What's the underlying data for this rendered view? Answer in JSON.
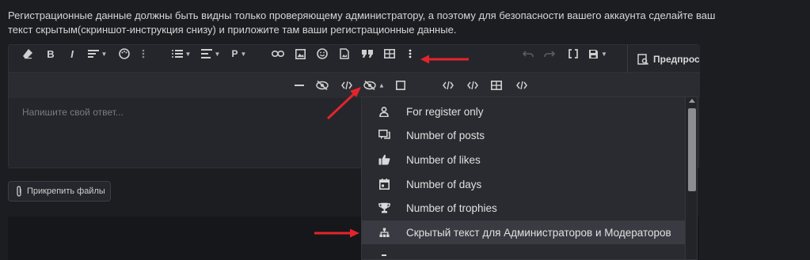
{
  "notice_text": "Регистрационные данные должны быть видны только проверяющему администратору, а поэтому для безопасности вашего аккаунта сделайте ваш текст скрытым(скриншот-инструкция снизу) и приложите там ваши регистрационные данные.",
  "toolbar": {
    "bold": "B",
    "italic": "I",
    "paragraph": "P",
    "preview_label": "Предпросмотр"
  },
  "editor": {
    "placeholder": "Напишите свой ответ..."
  },
  "attach_label": "Прикрепить файлы",
  "dropdown": {
    "items": [
      {
        "label": "For register only",
        "icon": "user-icon"
      },
      {
        "label": "Number of posts",
        "icon": "comments-icon"
      },
      {
        "label": "Number of likes",
        "icon": "thumbs-up-icon"
      },
      {
        "label": "Number of days",
        "icon": "calendar-icon"
      },
      {
        "label": "Number of trophies",
        "icon": "trophy-icon"
      },
      {
        "label": "Скрытый текст для Администраторов и Модераторов",
        "icon": "sitemap-icon",
        "active": true
      }
    ]
  },
  "colors": {
    "background": "#1c1d21",
    "editor": "#25262b",
    "dropdown": "#2a2b30",
    "annotation_arrow": "#e3242b"
  }
}
